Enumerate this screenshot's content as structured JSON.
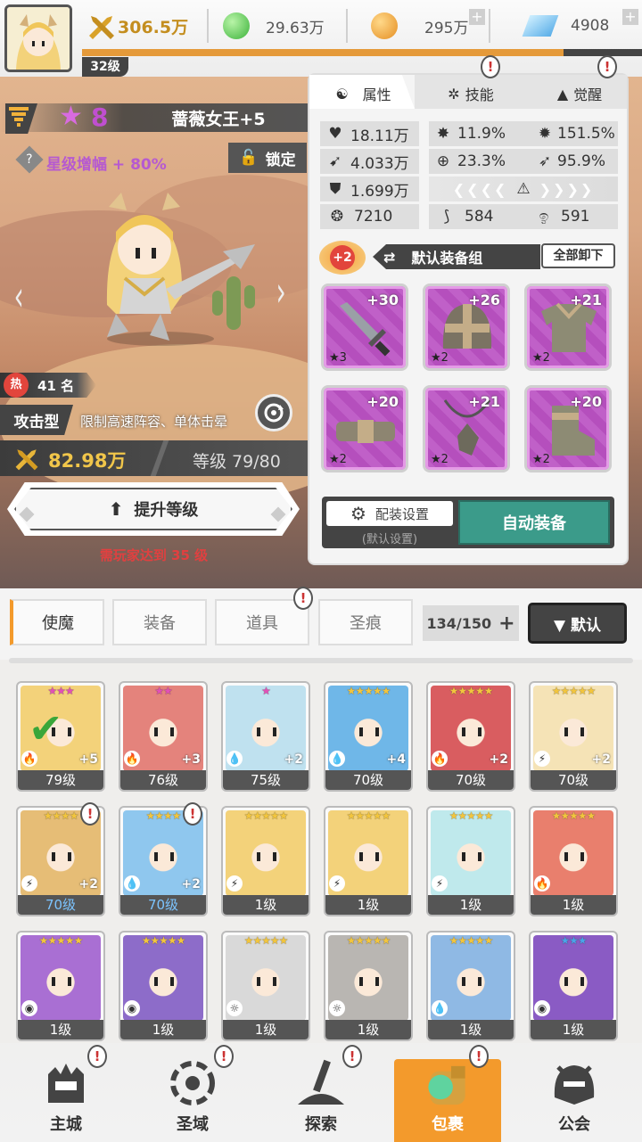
{
  "top": {
    "level": "32级",
    "power": "306.5万",
    "green_gem": "29.63万",
    "gold": "295万",
    "diamond": "4908",
    "xp_progress": 0.86
  },
  "hero": {
    "name": "蔷薇女王+5",
    "stars": "8",
    "star_boost_label": "星级增幅 + 80%",
    "lock_label": "锁定",
    "hot_icon": "热",
    "rank": "41 名",
    "type_label": "攻击型",
    "type_desc": "限制高速阵容、单体击晕",
    "power": "82.98万",
    "level_label": "等级 79/80",
    "upgrade_button": "提升等级",
    "upgrade_requirement": "需玩家达到 35 级"
  },
  "panel": {
    "tabs": [
      "属性",
      "技能",
      "觉醒"
    ],
    "stats": {
      "hp": "18.11万",
      "crit": "11.9%",
      "crit_dmg": "151.5%",
      "atk": "4.033万",
      "accuracy": "23.3%",
      "speed_pct": "95.9%",
      "def": "1.699万",
      "s1": "7210",
      "s2": "584",
      "s3": "591"
    },
    "set_badge": "+2",
    "set_label": "默认装备组",
    "unequip_all": "全部卸下",
    "equipment": [
      {
        "name": "sword",
        "plus": "+30",
        "stars": "★3"
      },
      {
        "name": "helmet",
        "plus": "+26",
        "stars": "★2"
      },
      {
        "name": "armor",
        "plus": "+21",
        "stars": "★2"
      },
      {
        "name": "belt",
        "plus": "+20",
        "stars": "★2"
      },
      {
        "name": "necklace",
        "plus": "+21",
        "stars": "★2"
      },
      {
        "name": "boots",
        "plus": "+20",
        "stars": "★2"
      }
    ],
    "config_button": "配装设置",
    "config_sub": "(默认设置)",
    "auto_equip": "自动装备"
  },
  "filter": {
    "tabs": [
      "使魔",
      "装备",
      "道具",
      "圣痕"
    ],
    "count": "134/150",
    "add_symbol": "+",
    "sort_label": "▼ 默认"
  },
  "cards": [
    {
      "level": "79级",
      "stars": "★★★",
      "star_color": "#e24fb7",
      "plus": "+5",
      "color": "#f3d27a",
      "elem": "fire",
      "elem_sym": "🔥",
      "check": true
    },
    {
      "level": "76级",
      "stars": "★★",
      "star_color": "#e24fb7",
      "plus": "+3",
      "color": "#e4837c",
      "elem": "fire",
      "elem_sym": "🔥"
    },
    {
      "level": "75级",
      "stars": "★",
      "star_color": "#e24fb7",
      "plus": "+2",
      "color": "#bfe1ef",
      "elem": "water",
      "elem_sym": "💧"
    },
    {
      "level": "70级",
      "stars": "★★★★★",
      "star_color": "#f2c53d",
      "plus": "+4",
      "color": "#6fb7e8",
      "elem": "water",
      "elem_sym": "💧"
    },
    {
      "level": "70级",
      "stars": "★★★★★",
      "star_color": "#f2c53d",
      "plus": "+2",
      "color": "#d95d60",
      "elem": "fire",
      "elem_sym": "🔥"
    },
    {
      "level": "70级",
      "stars": "★★★★★",
      "star_color": "#f2c53d",
      "plus": "+2",
      "color": "#f5e3b6",
      "elem": "thunder",
      "elem_sym": "⚡"
    },
    {
      "level": "70级",
      "stars": "★★★★",
      "star_color": "#f2c53d",
      "plus": "+2",
      "color": "#e6bd76",
      "elem": "thunder",
      "elem_sym": "⚡",
      "blue_level": true
    },
    {
      "level": "70级",
      "stars": "★★★★",
      "star_color": "#f2c53d",
      "plus": "+2",
      "color": "#8fc7ee",
      "elem": "water",
      "elem_sym": "💧",
      "blue_level": true
    },
    {
      "level": "1级",
      "stars": "★★★★★",
      "star_color": "#f2c53d",
      "plus": "",
      "color": "#f3d27a",
      "elem": "thunder",
      "elem_sym": "⚡"
    },
    {
      "level": "1级",
      "stars": "★★★★★",
      "star_color": "#f2c53d",
      "plus": "",
      "color": "#f3d27a",
      "elem": "thunder",
      "elem_sym": "⚡"
    },
    {
      "level": "1级",
      "stars": "★★★★★",
      "star_color": "#f2c53d",
      "plus": "",
      "color": "#bfe9ec",
      "elem": "thunder",
      "elem_sym": "⚡"
    },
    {
      "level": "1级",
      "stars": "★★★★★",
      "star_color": "#f2c53d",
      "plus": "",
      "color": "#e97f6d",
      "elem": "fire",
      "elem_sym": "🔥"
    },
    {
      "level": "1级",
      "stars": "★★★★★",
      "star_color": "#f2c53d",
      "plus": "",
      "color": "#a96fd3",
      "elem": "dark",
      "elem_sym": "◉"
    },
    {
      "level": "1级",
      "stars": "★★★★★",
      "star_color": "#f2c53d",
      "plus": "",
      "color": "#8d6cc9",
      "elem": "dark",
      "elem_sym": "◉"
    },
    {
      "level": "1级",
      "stars": "★★★★★",
      "star_color": "#f2c53d",
      "plus": "",
      "color": "#d9d9d9",
      "elem": "light",
      "elem_sym": "☼"
    },
    {
      "level": "1级",
      "stars": "★★★★★",
      "star_color": "#f2c53d",
      "plus": "",
      "color": "#b9b6b2",
      "elem": "light",
      "elem_sym": "☼"
    },
    {
      "level": "1级",
      "stars": "★★★★★",
      "star_color": "#f2c53d",
      "plus": "",
      "color": "#8fb9e4",
      "elem": "water",
      "elem_sym": "💧"
    },
    {
      "level": "1级",
      "stars": "★★★",
      "star_color": "#4aa3e8",
      "plus": "",
      "color": "#8a5bc4",
      "elem": "dark",
      "elem_sym": "◉"
    }
  ],
  "nav": [
    {
      "label": "主城",
      "icon": "castle-icon",
      "alert": true,
      "active": false
    },
    {
      "label": "圣域",
      "icon": "vortex-icon",
      "alert": true,
      "active": false
    },
    {
      "label": "探索",
      "icon": "sword-stone-icon",
      "alert": true,
      "active": false
    },
    {
      "label": "包裹",
      "icon": "bag-icon",
      "alert": true,
      "active": true
    },
    {
      "label": "公会",
      "icon": "guild-helmet-icon",
      "alert": false,
      "active": false
    }
  ],
  "alert_symbol": "!",
  "colors": {
    "accent_orange": "#f39a2c",
    "auto_equip_green": "#3b9b8a",
    "xp_orange": "#e59a3a",
    "grade_purple": "#c060c8"
  }
}
